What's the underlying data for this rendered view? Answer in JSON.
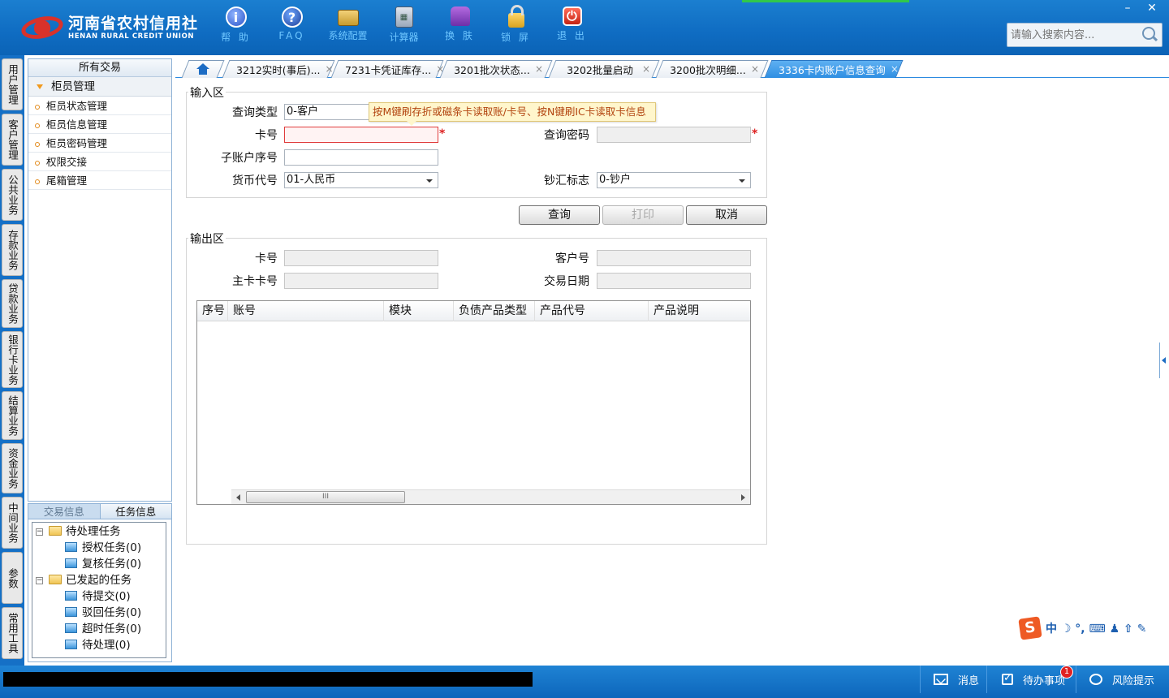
{
  "brand": {
    "name_cn": "河南省农村信用社",
    "name_en": "HENAN RURAL CREDIT UNION"
  },
  "toolbar": [
    {
      "label": "帮 助",
      "icon": "info-icon",
      "glyph": "i"
    },
    {
      "label": "FAQ",
      "icon": "question-icon",
      "glyph": "?"
    },
    {
      "label": "系统配置",
      "icon": "toolbox-icon",
      "glyph": ""
    },
    {
      "label": "计算器",
      "icon": "calculator-icon",
      "glyph": "▦"
    },
    {
      "label": "换 肤",
      "icon": "shirt-icon",
      "glyph": ""
    },
    {
      "label": "锁 屏",
      "icon": "lock-icon",
      "glyph": ""
    },
    {
      "label": "退 出",
      "icon": "power-icon",
      "glyph": "⏻"
    }
  ],
  "window": {
    "minimize": "–",
    "close": "✕"
  },
  "search": {
    "placeholder": "请输入搜索内容..."
  },
  "vtabs": [
    "用户管理",
    "客户管理",
    "公共业务",
    "存款业务",
    "贷款业务",
    "银行卡业务",
    "结算业务",
    "资金业务",
    "中间业务",
    "参数",
    "常用工具"
  ],
  "menu": {
    "header": "所有交易",
    "group": "柜员管理",
    "items": [
      "柜员状态管理",
      "柜员信息管理",
      "柜员密码管理",
      "权限交接",
      "尾箱管理"
    ]
  },
  "task_panel": {
    "tabs": [
      "交易信息",
      "任务信息"
    ],
    "pending": "待处理任务",
    "pending_items": [
      "授权任务(0)",
      "复核任务(0)"
    ],
    "initiated": "已发起的任务",
    "initiated_items": [
      "待提交(0)",
      "驳回任务(0)",
      "超时任务(0)",
      "待处理(0)"
    ]
  },
  "tabs": [
    {
      "label": "",
      "home": true
    },
    {
      "label": "3212实时(事后)..."
    },
    {
      "label": "7231卡凭证库存..."
    },
    {
      "label": "3201批次状态..."
    },
    {
      "label": "3202批量启动"
    },
    {
      "label": "3200批次明细..."
    },
    {
      "label": "3336卡内账户信息查询",
      "active": true
    }
  ],
  "tab_close": "×",
  "input_section": {
    "legend": "输入区",
    "query_type_label": "查询类型",
    "query_type_value": "0-客户",
    "tooltip": "按M键刷存折或磁条卡读取账/卡号、按N键刷IC卡读取卡信息",
    "card_no_label": "卡号",
    "card_no_value": "",
    "password_label": "查询密码",
    "sub_account_label": "子账户序号",
    "sub_account_value": "",
    "currency_label": "货币代号",
    "currency_value": "01-人民币",
    "cash_flag_label": "钞汇标志",
    "cash_flag_value": "0-钞户",
    "required_mark": "*"
  },
  "buttons": {
    "query": "查询",
    "print": "打印",
    "cancel": "取消"
  },
  "output_section": {
    "legend": "输出区",
    "card_no_label": "卡号",
    "customer_no_label": "客户号",
    "main_card_label": "主卡卡号",
    "trade_date_label": "交易日期"
  },
  "grid": {
    "columns": [
      "序号",
      "账号",
      "模块",
      "负债产品类型",
      "产品代号",
      "产品说明"
    ],
    "rows": [],
    "scroll_grip": "III"
  },
  "ime": {
    "logo": "S",
    "mode": "中 ☽ °, ⌨ ♟ ⇧ ✎"
  },
  "statusbar": {
    "message": "消息",
    "todo": "待办事项",
    "todo_count": "1",
    "risk": "风险提示"
  },
  "colors": {
    "header_blue": "#0f6cc2",
    "active_tab": "#2f8fe2",
    "tooltip_bg": "#fff6cc",
    "required_red": "#d22222"
  }
}
